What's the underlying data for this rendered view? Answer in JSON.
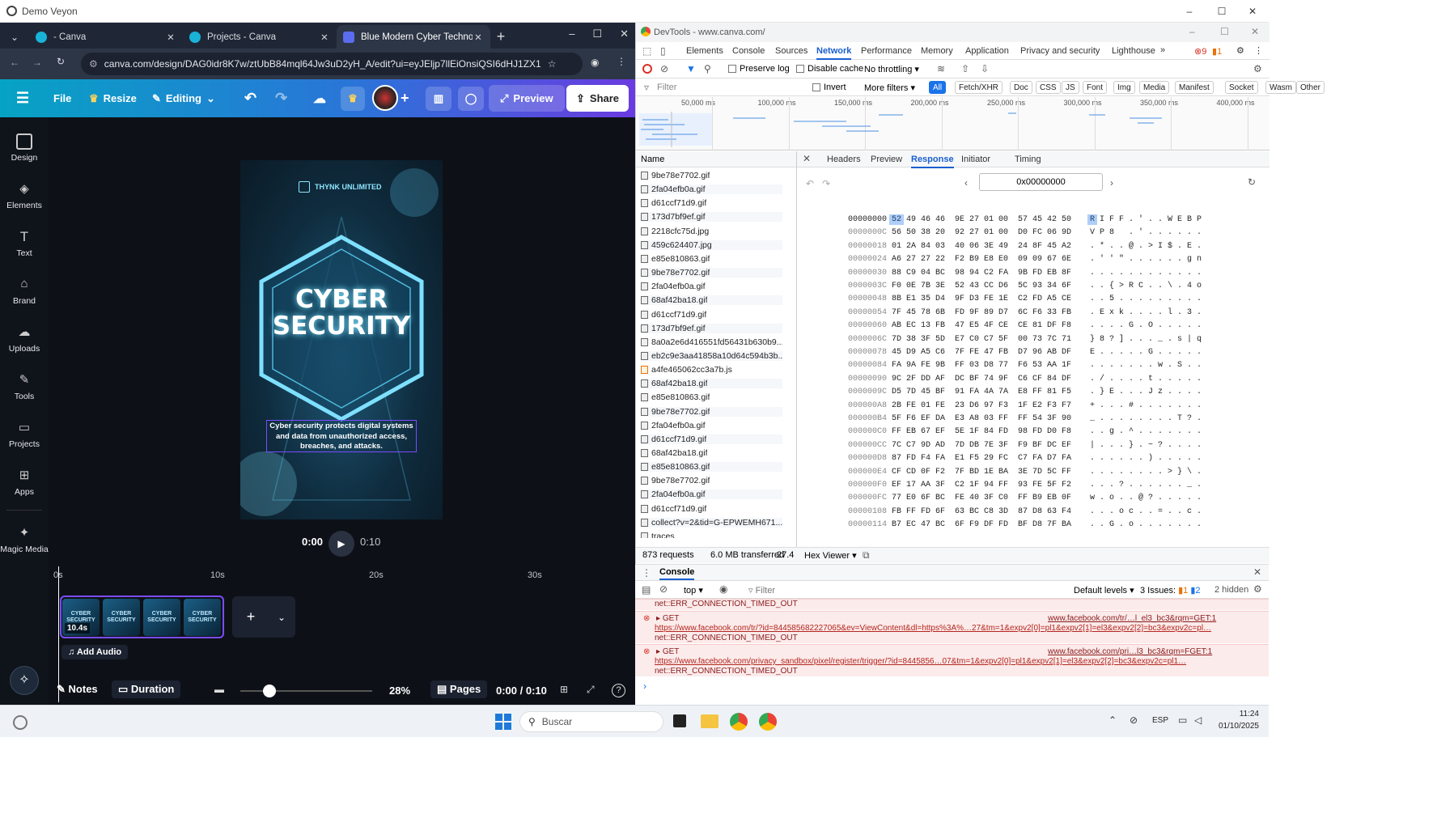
{
  "window": {
    "title": "Demo Veyon"
  },
  "browser": {
    "tabs": [
      {
        "label": "- Canva"
      },
      {
        "label": "Projects - Canva"
      },
      {
        "label": "Blue Modern Cyber Technolog"
      }
    ],
    "url": "canva.com/design/DAG0idr8K7w/ztUbB84mql64Jw3uD2yH_A/edit?ui=eyJEljp7llEiOnsiQSI6dHJ1ZX19fQ"
  },
  "canva": {
    "toolbar": {
      "file": "File",
      "resize": "Resize",
      "editing": "Editing",
      "preview": "Preview",
      "share": "Share"
    },
    "sidebar": [
      {
        "label": "Design"
      },
      {
        "label": "Elements"
      },
      {
        "label": "Text"
      },
      {
        "label": "Brand"
      },
      {
        "label": "Uploads"
      },
      {
        "label": "Tools"
      },
      {
        "label": "Projects"
      },
      {
        "label": "Apps"
      },
      {
        "label": "Magic Media"
      }
    ],
    "design": {
      "brand": "THYNK UNLIMITED",
      "title_line1": "CYBER",
      "title_line2": "SECURITY",
      "body": "Cyber security protects digital systems and data from unauthorized access, breaches, and attacks."
    },
    "playback": {
      "current": "0:00",
      "end": "0:10"
    },
    "ruler": [
      "0s",
      "10s",
      "20s",
      "30s"
    ],
    "clip": {
      "duration": "10.4s",
      "thumb_text": "CYBER SECURITY"
    },
    "add_audio": "Add Audio",
    "footer": {
      "notes": "Notes",
      "duration": "Duration",
      "zoom": "28%",
      "pages": "Pages",
      "time": "0:00 / 0:10",
      "zoom_level": 0.22
    }
  },
  "devtools": {
    "title": "DevTools - www.canva.com/",
    "tabs": [
      "Elements",
      "Console",
      "Sources",
      "Network",
      "Performance",
      "Memory",
      "Application",
      "Privacy and security",
      "Lighthouse"
    ],
    "badges": {
      "errors": "9",
      "warnings": "1"
    },
    "toolbar": {
      "preserve_log": "Preserve log",
      "disable_cache": "Disable cache",
      "throttling": "No throttling"
    },
    "filter": {
      "placeholder": "Filter",
      "invert": "Invert",
      "more_filters": "More filters"
    },
    "types": [
      "All",
      "Fetch/XHR",
      "Doc",
      "CSS",
      "JS",
      "Font",
      "Img",
      "Media",
      "Manifest",
      "Socket",
      "Wasm",
      "Other"
    ],
    "timeline_ticks": [
      "50,000 ms",
      "100,000 ms",
      "150,000 ms",
      "200,000 ms",
      "250,000 ms",
      "300,000 ms",
      "350,000 ms",
      "400,000 ms"
    ],
    "name_header": "Name",
    "detail_tabs": [
      "Headers",
      "Preview",
      "Response",
      "Initiator",
      "Timing"
    ],
    "hex_address": "0x00000000",
    "requests": [
      "9be78e7702.gif",
      "2fa04efb0a.gif",
      "d61ccf71d9.gif",
      "173d7bf9ef.gif",
      "2218cfc75d.jpg",
      "459c624407.jpg",
      "e85e810863.gif",
      "9be78e7702.gif",
      "2fa04efb0a.gif",
      "68af42ba18.gif",
      "d61ccf71d9.gif",
      "173d7bf9ef.gif",
      "8a0a2e6d416551fd56431b630b9...",
      "eb2c9e3aa41858a10d64c594b3b...",
      "a4fe465062cc3a7b.js",
      "68af42ba18.gif",
      "e85e810863.gif",
      "9be78e7702.gif",
      "2fa04efb0a.gif",
      "d61ccf71d9.gif",
      "68af42ba18.gif",
      "e85e810863.gif",
      "9be78e7702.gif",
      "2fa04efb0a.gif",
      "d61ccf71d9.gif",
      "collect?v=2&tid=G-EPWEMH671...",
      "traces"
    ],
    "hex_rows": [
      {
        "off": "00000000",
        "bytes": "52 49 46 46  9E 27 01 00  57 45 42 50",
        "ascii": "R I F F . ' . . W E B P"
      },
      {
        "off": "0000000C",
        "bytes": "56 50 38 20  92 27 01 00  D0 FC 06 9D",
        "ascii": "V P 8   . ' . . . . . ."
      },
      {
        "off": "00000018",
        "bytes": "01 2A 84 03  40 06 3E 49  24 8F 45 A2",
        "ascii": ". * . . @ . > I $ . E ."
      },
      {
        "off": "00000024",
        "bytes": "A6 27 27 22  F2 B9 E8 E0  09 09 67 6E",
        "ascii": ". ' ' \" . . . . . . g n"
      },
      {
        "off": "00000030",
        "bytes": "88 C9 04 BC  98 94 C2 FA  9B FD EB 8F",
        "ascii": ". . . . . . . . . . . ."
      },
      {
        "off": "0000003C",
        "bytes": "F0 0E 7B 3E  52 43 CC D6  5C 93 34 6F",
        "ascii": ". . { > R C . . \\ . 4 o"
      },
      {
        "off": "00000048",
        "bytes": "8B E1 35 D4  9F D3 FE 1E  C2 FD A5 CE",
        "ascii": ". . 5 . . . . . . . . ."
      },
      {
        "off": "00000054",
        "bytes": "7F 45 78 6B  FD 9F 89 D7  6C F6 33 FB",
        "ascii": ". E x k . . . . l . 3 ."
      },
      {
        "off": "00000060",
        "bytes": "AB EC 13 FB  47 E5 4F CE  CE 81 DF F8",
        "ascii": ". . . . G . O . . . . ."
      },
      {
        "off": "0000006C",
        "bytes": "7D 38 3F 5D  E7 C0 C7 5F  00 73 7C 71",
        "ascii": "} 8 ? ] . . . _ . s | q"
      },
      {
        "off": "00000078",
        "bytes": "45 D9 A5 C6  7F FE 47 FB  D7 96 AB DF",
        "ascii": "E . . . . . G . . . . ."
      },
      {
        "off": "00000084",
        "bytes": "FA 9A FE 9B  FF 03 D8 77  F6 53 AA 1F",
        "ascii": ". . . . . . . w . S . ."
      },
      {
        "off": "00000090",
        "bytes": "9C 2F DD AF  DC BF 74 9F  C6 CF 84 DF",
        "ascii": ". / . . . . t . . . . ."
      },
      {
        "off": "0000009C",
        "bytes": "D5 7D 45 BF  91 FA 4A 7A  E8 FF 81 F5",
        "ascii": ". } E . . . J z . . . ."
      },
      {
        "off": "000000A8",
        "bytes": "2B FE 01 FE  23 D6 97 F3  1F E2 F3 F7",
        "ascii": "+ . . . # . . . . . . ."
      },
      {
        "off": "000000B4",
        "bytes": "5F F6 EF DA  E3 A8 03 FF  FF 54 3F 90",
        "ascii": "_ . . . . . . . . T ? ."
      },
      {
        "off": "000000C0",
        "bytes": "FF EB 67 EF  5E 1F 84 FD  98 FD D0 F8",
        "ascii": ". . g . ^ . . . . . . ."
      },
      {
        "off": "000000CC",
        "bytes": "7C C7 9D AD  7D DB 7E 3F  F9 BF DC EF",
        "ascii": "| . . . } . ~ ? . . . ."
      },
      {
        "off": "000000D8",
        "bytes": "87 FD F4 FA  E1 F5 29 FC  C7 FA D7 FA",
        "ascii": ". . . . . . ) . . . . ."
      },
      {
        "off": "000000E4",
        "bytes": "CF CD 0F F2  7F BD 1E BA  3E 7D 5C FF",
        "ascii": ". . . . . . . . > } \\ ."
      },
      {
        "off": "000000F0",
        "bytes": "EF 17 AA 3F  C2 1F 94 FF  93 FE 5F F2",
        "ascii": ". . . ? . . . . . . _ ."
      },
      {
        "off": "000000FC",
        "bytes": "77 E0 6F BC  FE 40 3F C0  FF B9 EB 0F",
        "ascii": "w . o . . @ ? . . . . ."
      },
      {
        "off": "00000108",
        "bytes": "FB FF FD 6F  63 BC C8 3D  87 D8 63 F4",
        "ascii": ". . . o c . . = . . c ."
      },
      {
        "off": "00000114",
        "bytes": "B7 EC 47 BC  6F F9 DF FD  BF D8 7F BA",
        "ascii": ". . G . o . . . . . . ."
      }
    ],
    "status": {
      "requests": "873 requests",
      "transferred": "6.0 MB transferred",
      "resources": "27.4",
      "viewer": "Hex Viewer"
    },
    "console": {
      "tab": "Console",
      "context": "top",
      "filter": "Filter",
      "levels": "Default levels",
      "issues": "3 Issues:",
      "issue_err": "1",
      "issue_info": "2",
      "hidden": "2 hidden",
      "lines": [
        {
          "first": "net::ERR_CONNECTION_TIMED_OUT"
        },
        {
          "method": "GET",
          "src": "www.facebook.com/tr/…l_el3_bc3&rqm=GET:1",
          "url": "https://www.facebook.com/tr/?id=844585682227065&ev=ViewContent&dl=https%3A%…27&tm=1&expv2[0]=pl1&expv2[1]=el3&expv2[2]=bc3&expv2c=pl…",
          "err": "net::ERR_CONNECTION_TIMED_OUT"
        },
        {
          "method": "GET",
          "src": "www.facebook.com/pri…l3_bc3&rqm=FGET:1",
          "url": "https://www.facebook.com/privacy_sandbox/pixel/register/trigger/?id=8445856…07&tm=1&expv2[0]=pl1&expv2[1]=el3&expv2[2]=bc3&expv2c=pl1…",
          "err": "net::ERR_CONNECTION_TIMED_OUT"
        }
      ]
    }
  },
  "taskbar": {
    "search": "Buscar",
    "lang": "ESP",
    "time": "11:24",
    "date": "01/10/2025"
  }
}
